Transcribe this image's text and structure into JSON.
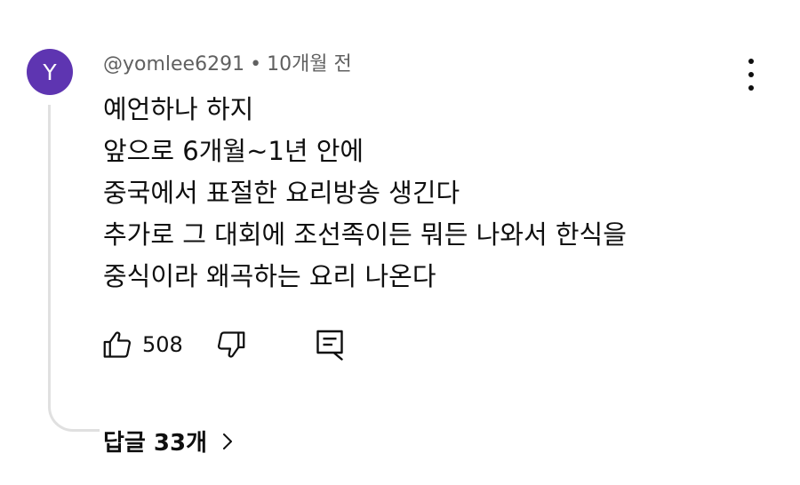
{
  "comment": {
    "avatar_letter": "Y",
    "avatar_color": "#5e35b1",
    "author": "@yomlee6291",
    "separator": "•",
    "time": "10개월 전",
    "lines": [
      "예언하나 하지",
      "앞으로 6개월~1년 안에",
      "중국에서 표절한 요리방송 생긴다",
      "추가로 그 대회에 조선족이든 뭐든 나와서 한식을",
      "중식이라 왜곡하는 요리 나온다"
    ],
    "like_count": "508",
    "icons": {
      "like": "thumb-up-icon",
      "dislike": "thumb-down-icon",
      "reply": "comment-icon",
      "more": "more-vertical-icon",
      "expand": "chevron-right-icon"
    },
    "replies_label": "답글 33개"
  }
}
